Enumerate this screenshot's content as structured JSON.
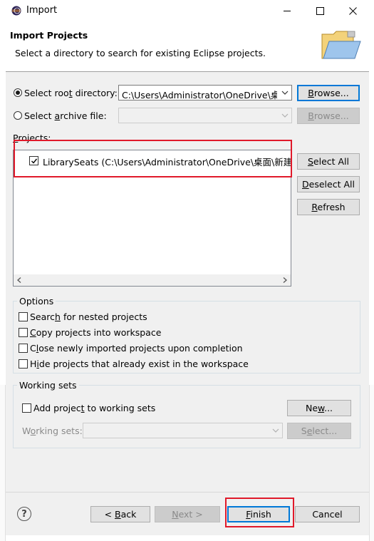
{
  "window": {
    "title": "Import"
  },
  "header": {
    "title": "Import Projects",
    "description": "Select a directory to search for existing Eclipse projects."
  },
  "source": {
    "root_dir_label_pre": "Select roo",
    "root_dir_label_u": "t",
    "root_dir_label_post": " directory:",
    "root_dir_value": "C:\\Users\\Administrator\\OneDrive\\桌面",
    "archive_label_pre": "Select ",
    "archive_label_u": "a",
    "archive_label_post": "rchive file:",
    "browse_root_u": "B",
    "browse_root_rest": "rowse...",
    "browse_archive_u": "B",
    "browse_archive_rest": "rowse..."
  },
  "projects": {
    "label_u": "P",
    "label_rest": "rojects:",
    "items": [
      {
        "label": "LibrarySeats (C:\\Users\\Administrator\\OneDrive\\桌面\\新建文件夹\\LibrarySeats)",
        "checked": true
      }
    ],
    "select_all_u": "S",
    "select_all_rest": "elect All",
    "deselect_all_u": "D",
    "deselect_all_rest": "eselect All",
    "refresh_u": "R",
    "refresh_rest": "efresh"
  },
  "options": {
    "title": "Options",
    "search_nested": {
      "pre": "Searc",
      "u": "h",
      "post": " for nested projects"
    },
    "copy_projects": {
      "pre": "",
      "u": "C",
      "post": "opy projects into workspace"
    },
    "close_imported": {
      "pre": "C",
      "u": "l",
      "post": "ose newly imported projects upon completion"
    },
    "hide_projects": {
      "pre": "H",
      "u": "i",
      "post": "de projects that already exist in the workspace"
    }
  },
  "working_sets": {
    "title": "Working sets",
    "add_label": {
      "pre": "Add projec",
      "u": "t",
      "post": " to working sets"
    },
    "new_button": {
      "pre": "Ne",
      "u": "w",
      "post": "..."
    },
    "sets_label": {
      "pre": "W",
      "u": "o",
      "post": "rking sets:"
    },
    "select_button": {
      "pre": "S",
      "u": "e",
      "post": "lect..."
    }
  },
  "footer": {
    "help_icon": "?",
    "back_pre": "< ",
    "back_u": "B",
    "back_post": "ack",
    "next_u": "N",
    "next_post": "ext >",
    "finish_u": "F",
    "finish_post": "inish",
    "cancel": "Cancel"
  },
  "highlight_color": "#e0192a",
  "accent_color": "#0078d7"
}
